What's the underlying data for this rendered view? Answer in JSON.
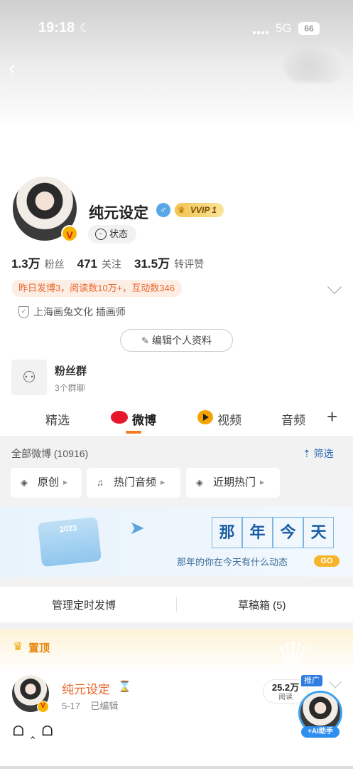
{
  "status_bar": {
    "time": "19:18",
    "network": "5G",
    "battery": "66"
  },
  "profile": {
    "name": "纯元设定",
    "vip_label": "VVIP 1",
    "status_chip": "状态",
    "stats": [
      {
        "num": "1.3万",
        "label": "粉丝"
      },
      {
        "num": "471",
        "label": "关注"
      },
      {
        "num": "31.5万",
        "label": "转评赞"
      }
    ],
    "yesterday": "昨日发博3，阅读数10万+，互动数346",
    "company": "上海画兔文化  插画师",
    "edit_button": "编辑个人资料"
  },
  "fan_group": {
    "title": "粉丝群",
    "subtitle": "3个群聊"
  },
  "tabs": [
    {
      "label": "精选"
    },
    {
      "label": "微博"
    },
    {
      "label": "视频"
    },
    {
      "label": "音频"
    }
  ],
  "filter": {
    "all_weibo": "全部微博 (10916)",
    "filter_link": "筛选",
    "chips": [
      "原创",
      "热门音频",
      "近期热门"
    ]
  },
  "banner": {
    "calendar_year": "2023",
    "title_chars": [
      "那",
      "年",
      "今",
      "天"
    ],
    "subtitle": "那年的你在今天有什么动态",
    "go_label": "GO"
  },
  "manage": {
    "scheduled": "管理定时发博",
    "drafts": "草稿箱 (5)"
  },
  "pinned": {
    "label": "置顶",
    "post": {
      "author": "纯元设定",
      "date": "5-17",
      "edited": "已编辑",
      "body": "ᗝ ‸ ᗝ",
      "promo": "推广",
      "read_count": "25.2万",
      "read_label": "阅读"
    }
  },
  "ai_assistant": {
    "label": "+AI助手"
  }
}
